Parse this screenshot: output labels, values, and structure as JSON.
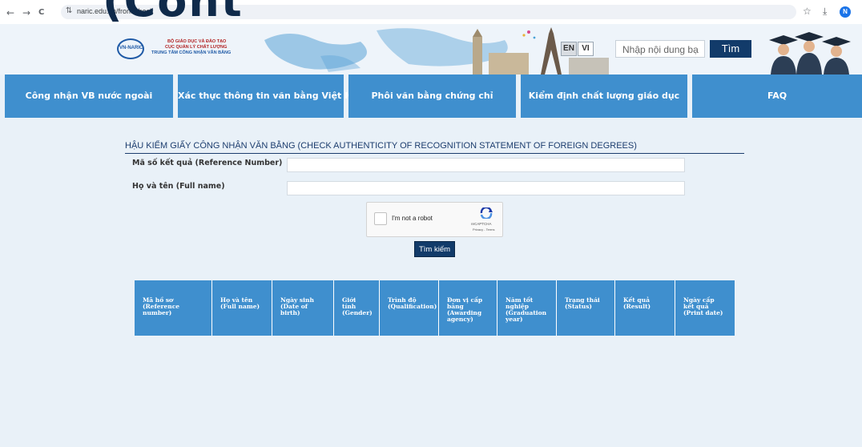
{
  "browser": {
    "url": "naric.edu.vn/front/check",
    "back_icon": "←",
    "forward_icon": "→",
    "reload_icon": "C",
    "site_info_icon": "⇅",
    "star_icon": "☆",
    "download_icon": "⤓",
    "profile_initial": "N",
    "overlay_text": "(Cont"
  },
  "header": {
    "logo_text": "VN-NARIC",
    "org_line1": "BỘ GIÁO DỤC VÀ ĐÀO TẠO",
    "org_line2": "CỤC QUẢN LÝ CHẤT LƯỢNG",
    "org_line3": "TRUNG TÂM CÔNG NHẬN VĂN BẰNG",
    "lang_en": "EN",
    "lang_vi": "VI",
    "search_placeholder": "Nhập nội dung bạ",
    "search_button": "Tìm"
  },
  "nav": {
    "items": [
      "Công nhận VB nước ngoài",
      "Xác thực thông tin văn bằng Việt Nam",
      "Phôi văn bằng chứng chỉ",
      "Kiểm định chất lượng giáo dục",
      "FAQ"
    ]
  },
  "form": {
    "title": "HẬU KIỂM GIẤY CÔNG NHẬN VĂN BẰNG (CHECK AUTHENTICITY OF RECOGNITION STATEMENT OF FOREIGN DEGREES)",
    "reference_label": "Mã số kết quả (Reference Number)",
    "reference_value": "",
    "name_label": "Họ và tên (Full name)",
    "name_value": "",
    "captcha_text": "I'm not a robot",
    "captcha_brand": "reCAPTCHA",
    "captcha_legal": "Privacy - Terms",
    "submit_label": "Tìm kiếm"
  },
  "table": {
    "headers": [
      "Mã hồ sơ\n(Reference\nnumber)",
      "Họ và tên\n(Full name)",
      "Ngày sinh\n(Date of\nbirth)",
      "Giới\ntính\n(Gender)",
      "Trình độ\n(Qualification)",
      "Đơn vị cấp\nbằng\n(Awarding\nagency)",
      "Năm tốt\nnghiệp\n(Graduation\nyear)",
      "Trạng thái\n(Status)",
      "Kết quả\n(Result)",
      "Ngày cấp\nkết quả\n(Print date)"
    ],
    "rows": []
  },
  "colors": {
    "nav_blue": "#3f8fce",
    "dark_navy": "#123b6a",
    "page_bg": "#e9f1f8"
  }
}
